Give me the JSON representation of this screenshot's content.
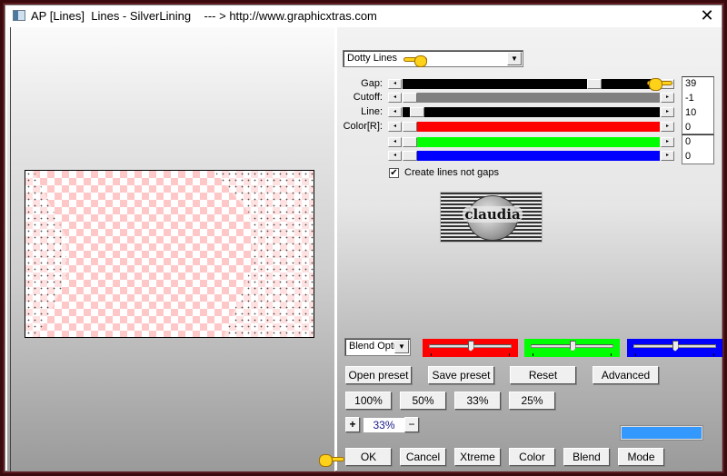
{
  "window": {
    "title": "AP [Lines]  Lines - SilverLining    --- > http://www.graphicxtras.com",
    "close_glyph": "✕"
  },
  "effect": {
    "selected": "Dotty Lines"
  },
  "sliders": [
    {
      "label": "Gap:",
      "value": "39",
      "fraction": 0.76,
      "fill": "#000000"
    },
    {
      "label": "Cutoff:",
      "value": "-1",
      "fraction": 0.0,
      "fill": "#808080"
    },
    {
      "label": "Line:",
      "value": "10",
      "fraction": 0.03,
      "fill": "#000000"
    },
    {
      "label": "Color[R]:",
      "value": "0",
      "fraction": 0.0,
      "fill": "#ff0000"
    },
    {
      "label": "",
      "value": "0",
      "fraction": 0.0,
      "fill": "#00ff00"
    },
    {
      "label": "",
      "value": "0",
      "fraction": 0.0,
      "fill": "#0000ff"
    }
  ],
  "arrows": {
    "left": "◂",
    "right": "▸",
    "down": "▼"
  },
  "checkbox": {
    "label": "Create lines not gaps",
    "checked": true,
    "mark": "✔"
  },
  "logo": {
    "text": "claudia"
  },
  "blend": {
    "selected": "Blend Opti",
    "rgb_sliders": [
      {
        "color": "#ff0000",
        "fraction": 0.5
      },
      {
        "color": "#00ff00",
        "fraction": 0.5
      },
      {
        "color": "#0000ff",
        "fraction": 0.5
      }
    ]
  },
  "presets": {
    "open": "Open preset",
    "save": "Save preset",
    "reset": "Reset",
    "advanced": "Advanced"
  },
  "zoom_presets": [
    "100%",
    "50%",
    "33%",
    "25%"
  ],
  "zoom": {
    "plus": "+",
    "value": "33%",
    "minus": "−"
  },
  "swatch_color": "#3399ff",
  "actions": {
    "ok": "OK",
    "cancel": "Cancel",
    "xtreme": "Xtreme",
    "color": "Color",
    "blend": "Blend",
    "mode": "Mode"
  }
}
